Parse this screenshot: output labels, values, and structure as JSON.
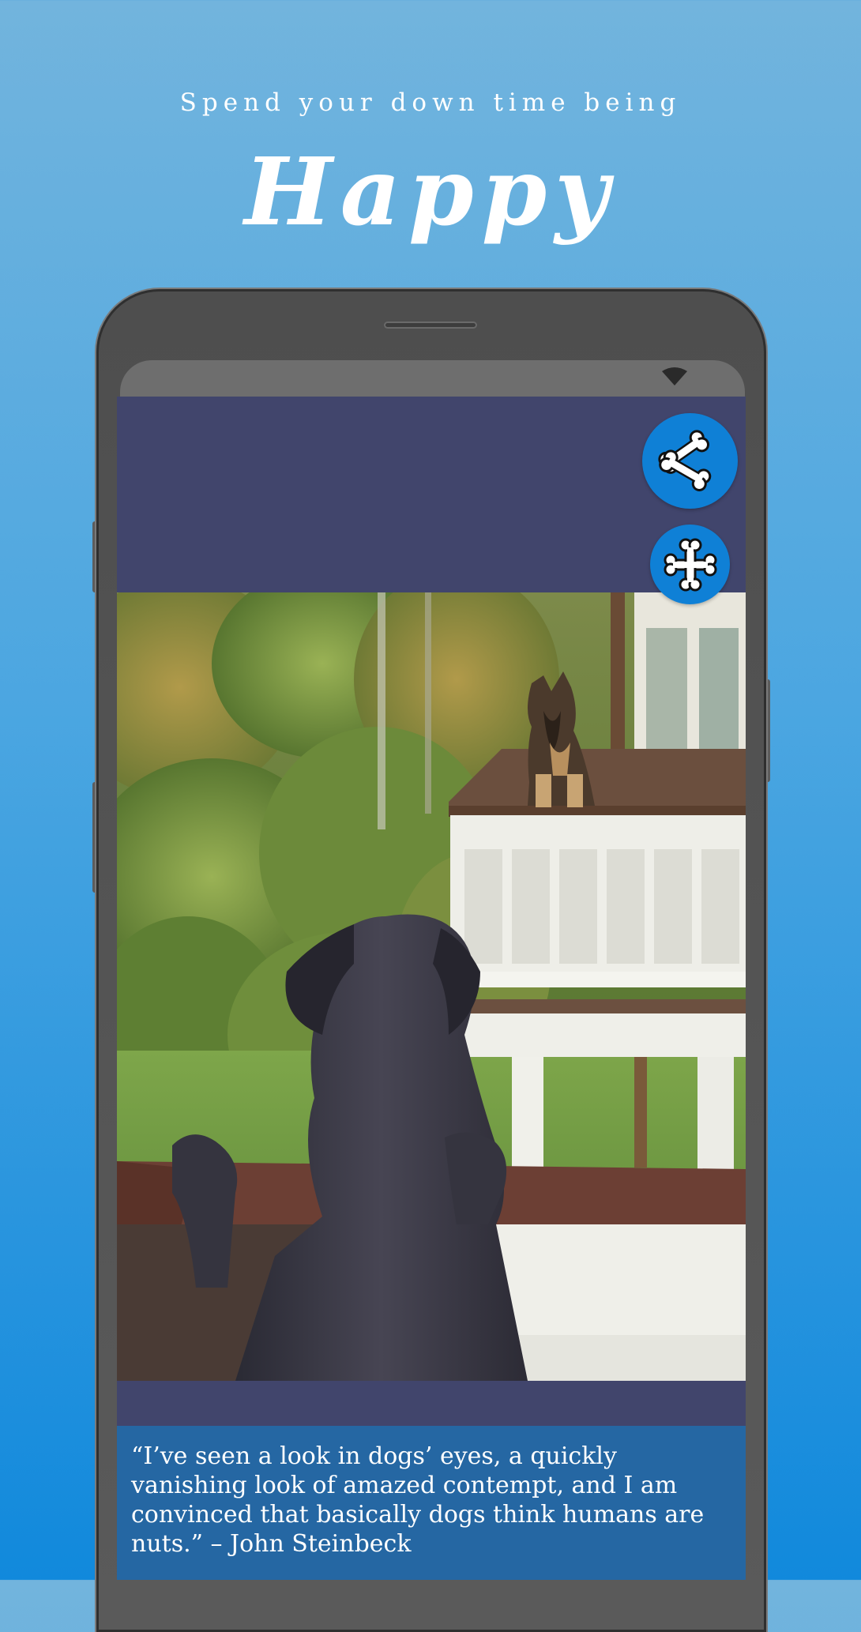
{
  "header": {
    "tagline": "Spend your down time being",
    "headline": "Happy"
  },
  "colors": {
    "background_top": "#72b4dd",
    "background_bottom": "#1189dc",
    "screen_bg": "#41456c",
    "quote_bg": "#2567a3",
    "fab": "#0f80d6"
  },
  "icons": {
    "share": "bone-share-icon",
    "expand": "bone-cross-icon",
    "wifi": "wifi-icon"
  },
  "quote": {
    "text": "“I’ve seen a look in dogs’ eyes, a quickly vanishing look of amazed contempt, and I am convinced that basically dogs think humans are nuts.” – John Steinbeck"
  }
}
